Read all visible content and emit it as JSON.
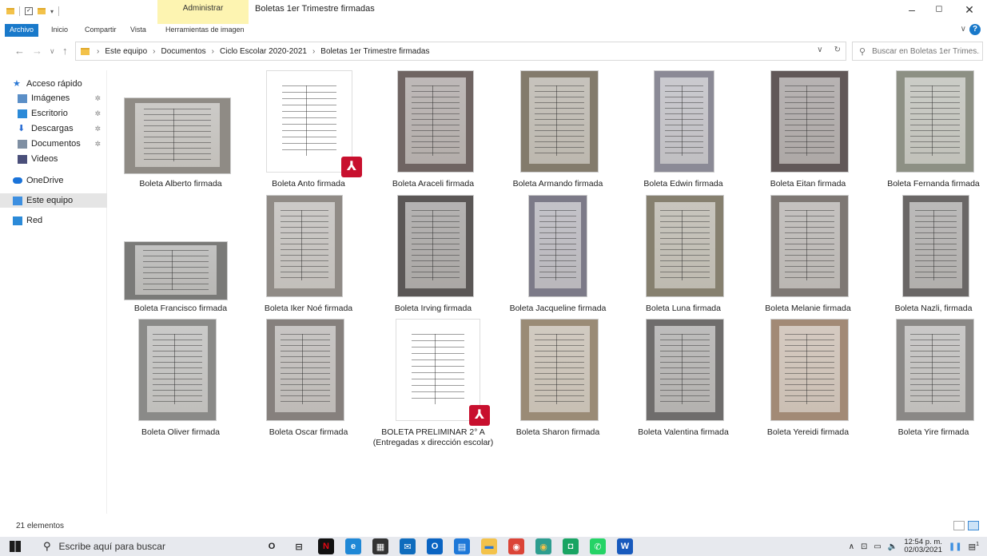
{
  "window": {
    "title": "Boletas 1er Trimestre firmadas",
    "context_tab_group": "Administrar",
    "controls": [
      "–",
      "◻",
      "✕"
    ]
  },
  "ribbon": {
    "tabs": [
      "Archivo",
      "Inicio",
      "Compartir",
      "Vista",
      "Herramientas de imagen"
    ],
    "help": "?"
  },
  "address": {
    "crumbs": [
      "Este equipo",
      "Documentos",
      "Ciclo Escolar 2020-2021",
      "Boletas 1er Trimestre firmadas"
    ]
  },
  "search": {
    "placeholder": "Buscar en Boletas 1er Trimes..."
  },
  "navpane": {
    "items": [
      {
        "label": "Acceso rápido",
        "icon": "star-icon",
        "color": "#2b78d4"
      },
      {
        "label": "Imágenes",
        "icon": "pictures-icon",
        "color": "#5b8fc7",
        "pinned": true
      },
      {
        "label": "Escritorio",
        "icon": "desktop-icon",
        "color": "#2b8ad8",
        "pinned": true
      },
      {
        "label": "Descargas",
        "icon": "download-icon",
        "color": "#2b6ed4",
        "pinned": true
      },
      {
        "label": "Documentos",
        "icon": "documents-icon",
        "color": "#7f8fa3",
        "pinned": true
      },
      {
        "label": "Videos",
        "icon": "videos-icon",
        "color": "#4a4f7a"
      },
      {
        "label": "OneDrive",
        "icon": "cloud-icon",
        "color": "#1a73d9"
      },
      {
        "label": "Este equipo",
        "icon": "computer-icon",
        "color": "#3d8fe0",
        "selected": true
      },
      {
        "label": "Red",
        "icon": "network-icon",
        "color": "#2b8ad8"
      }
    ],
    "pin_glyph": "✲"
  },
  "files": [
    {
      "name": "Boleta Alberto firmada",
      "kind": "img",
      "tone": "#8f8b85"
    },
    {
      "name": "Boleta Anto firmada",
      "kind": "pdf"
    },
    {
      "name": "Boleta Araceli firmada",
      "kind": "img",
      "tone": "#6f6462"
    },
    {
      "name": "Boleta Armando firmada",
      "kind": "img",
      "tone": "#837b6c"
    },
    {
      "name": "Boleta Edwin firmada",
      "kind": "img",
      "tone": "#8b8a96"
    },
    {
      "name": "Boleta Eitan firmada",
      "kind": "img",
      "tone": "#615858"
    },
    {
      "name": "Boleta Fernanda firmada",
      "kind": "img",
      "tone": "#8d9084"
    },
    {
      "name": "Boleta Francisco firmada",
      "kind": "img",
      "tone": "#7a7a78"
    },
    {
      "name": "Boleta Iker Noé firmada",
      "kind": "img",
      "tone": "#908b86"
    },
    {
      "name": "Boleta Irving firmada",
      "kind": "img",
      "tone": "#5b5756"
    },
    {
      "name": "Boleta Jacqueline firmada",
      "kind": "img",
      "tone": "#7c7a88"
    },
    {
      "name": "Boleta Luna firmada",
      "kind": "img",
      "tone": "#86806f"
    },
    {
      "name": "Boleta Melanie firmada",
      "kind": "img",
      "tone": "#7e7874"
    },
    {
      "name": "Boleta Nazli, firmada",
      "kind": "img",
      "tone": "#6a6766"
    },
    {
      "name": "Boleta Oliver firmada",
      "kind": "img",
      "tone": "#8a8a88"
    },
    {
      "name": "Boleta Oscar firmada",
      "kind": "img",
      "tone": "#86807d"
    },
    {
      "name": "BOLETA PRELIMINAR 2° A (Entregadas x dirección escolar)",
      "kind": "pdf"
    },
    {
      "name": "Boleta Sharon firmada",
      "kind": "img",
      "tone": "#9a8b76"
    },
    {
      "name": "Boleta Valentina firmada",
      "kind": "img",
      "tone": "#6f6d6c"
    },
    {
      "name": "Boleta Yereidi firmada",
      "kind": "img",
      "tone": "#a28a76"
    },
    {
      "name": "Boleta Yire firmada",
      "kind": "img",
      "tone": "#8a8886"
    }
  ],
  "status": {
    "count": "21 elementos"
  },
  "taskbar": {
    "search_placeholder": "Escribe aquí para buscar",
    "apps": [
      {
        "name": "cortana-icon",
        "color": "#e7e9ee",
        "glyph": "O",
        "fg": "#222"
      },
      {
        "name": "task-view-icon",
        "color": "#e7e9ee",
        "glyph": "⊟",
        "fg": "#222"
      },
      {
        "name": "netflix-icon",
        "color": "#111",
        "glyph": "N",
        "fg": "#e50914"
      },
      {
        "name": "edge-icon",
        "color": "#1f88d6",
        "glyph": "e",
        "fg": "#fff"
      },
      {
        "name": "store-icon",
        "color": "#333",
        "glyph": "▦",
        "fg": "#fff"
      },
      {
        "name": "mail-icon",
        "color": "#0f6cbd",
        "glyph": "✉",
        "fg": "#fff"
      },
      {
        "name": "outlook-icon",
        "color": "#0a64c2",
        "glyph": "O",
        "fg": "#fff"
      },
      {
        "name": "calendar-icon",
        "color": "#1e78d8",
        "glyph": "▤",
        "fg": "#fff"
      },
      {
        "name": "explorer-icon",
        "color": "#f3c24a",
        "glyph": "▬",
        "fg": "#2b78d4"
      },
      {
        "name": "chrome-icon",
        "color": "#db4437",
        "glyph": "◉",
        "fg": "#fff"
      },
      {
        "name": "chrome-canary-icon",
        "color": "#2d9d8f",
        "glyph": "◉",
        "fg": "#f3c24a"
      },
      {
        "name": "teams-meet-icon",
        "color": "#19a463",
        "glyph": "◘",
        "fg": "#fff"
      },
      {
        "name": "whatsapp-icon",
        "color": "#25d366",
        "glyph": "✆",
        "fg": "#fff"
      },
      {
        "name": "word-icon",
        "color": "#185abd",
        "glyph": "W",
        "fg": "#fff"
      }
    ],
    "time": "12:54 p. m.",
    "date": "02/03/2021",
    "notif_count": "1"
  }
}
